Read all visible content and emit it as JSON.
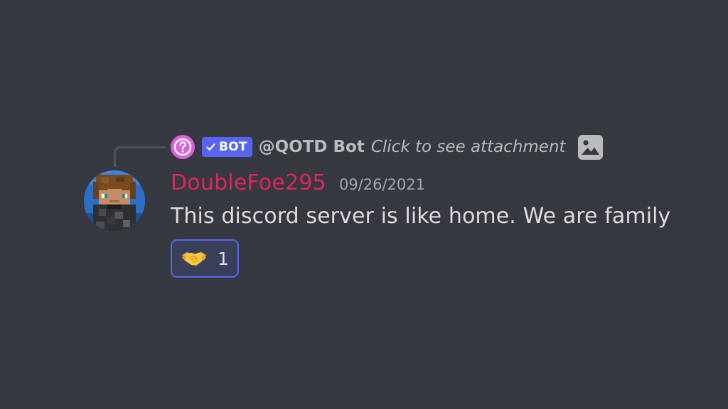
{
  "reply": {
    "bot_tag": "BOT",
    "author": "@QOTD Bot",
    "content": "Click to see attachment",
    "avatar_icon": "question-mark-icon",
    "attachment_icon": "image-icon",
    "avatar_color": "#dc5fe0",
    "tag_color": "#5865f2"
  },
  "message": {
    "username": "DoubleFoe295",
    "username_color": "#e0255f",
    "timestamp": "09/26/2021",
    "text": "This discord server is like home. We are family",
    "avatar": "minecraft-skin-avatar"
  },
  "reactions": [
    {
      "emoji": "handshake",
      "count": "1",
      "active": true
    }
  ],
  "theme": {
    "background": "#36393f",
    "text": "#dcddde",
    "muted": "#b9bbbe"
  }
}
